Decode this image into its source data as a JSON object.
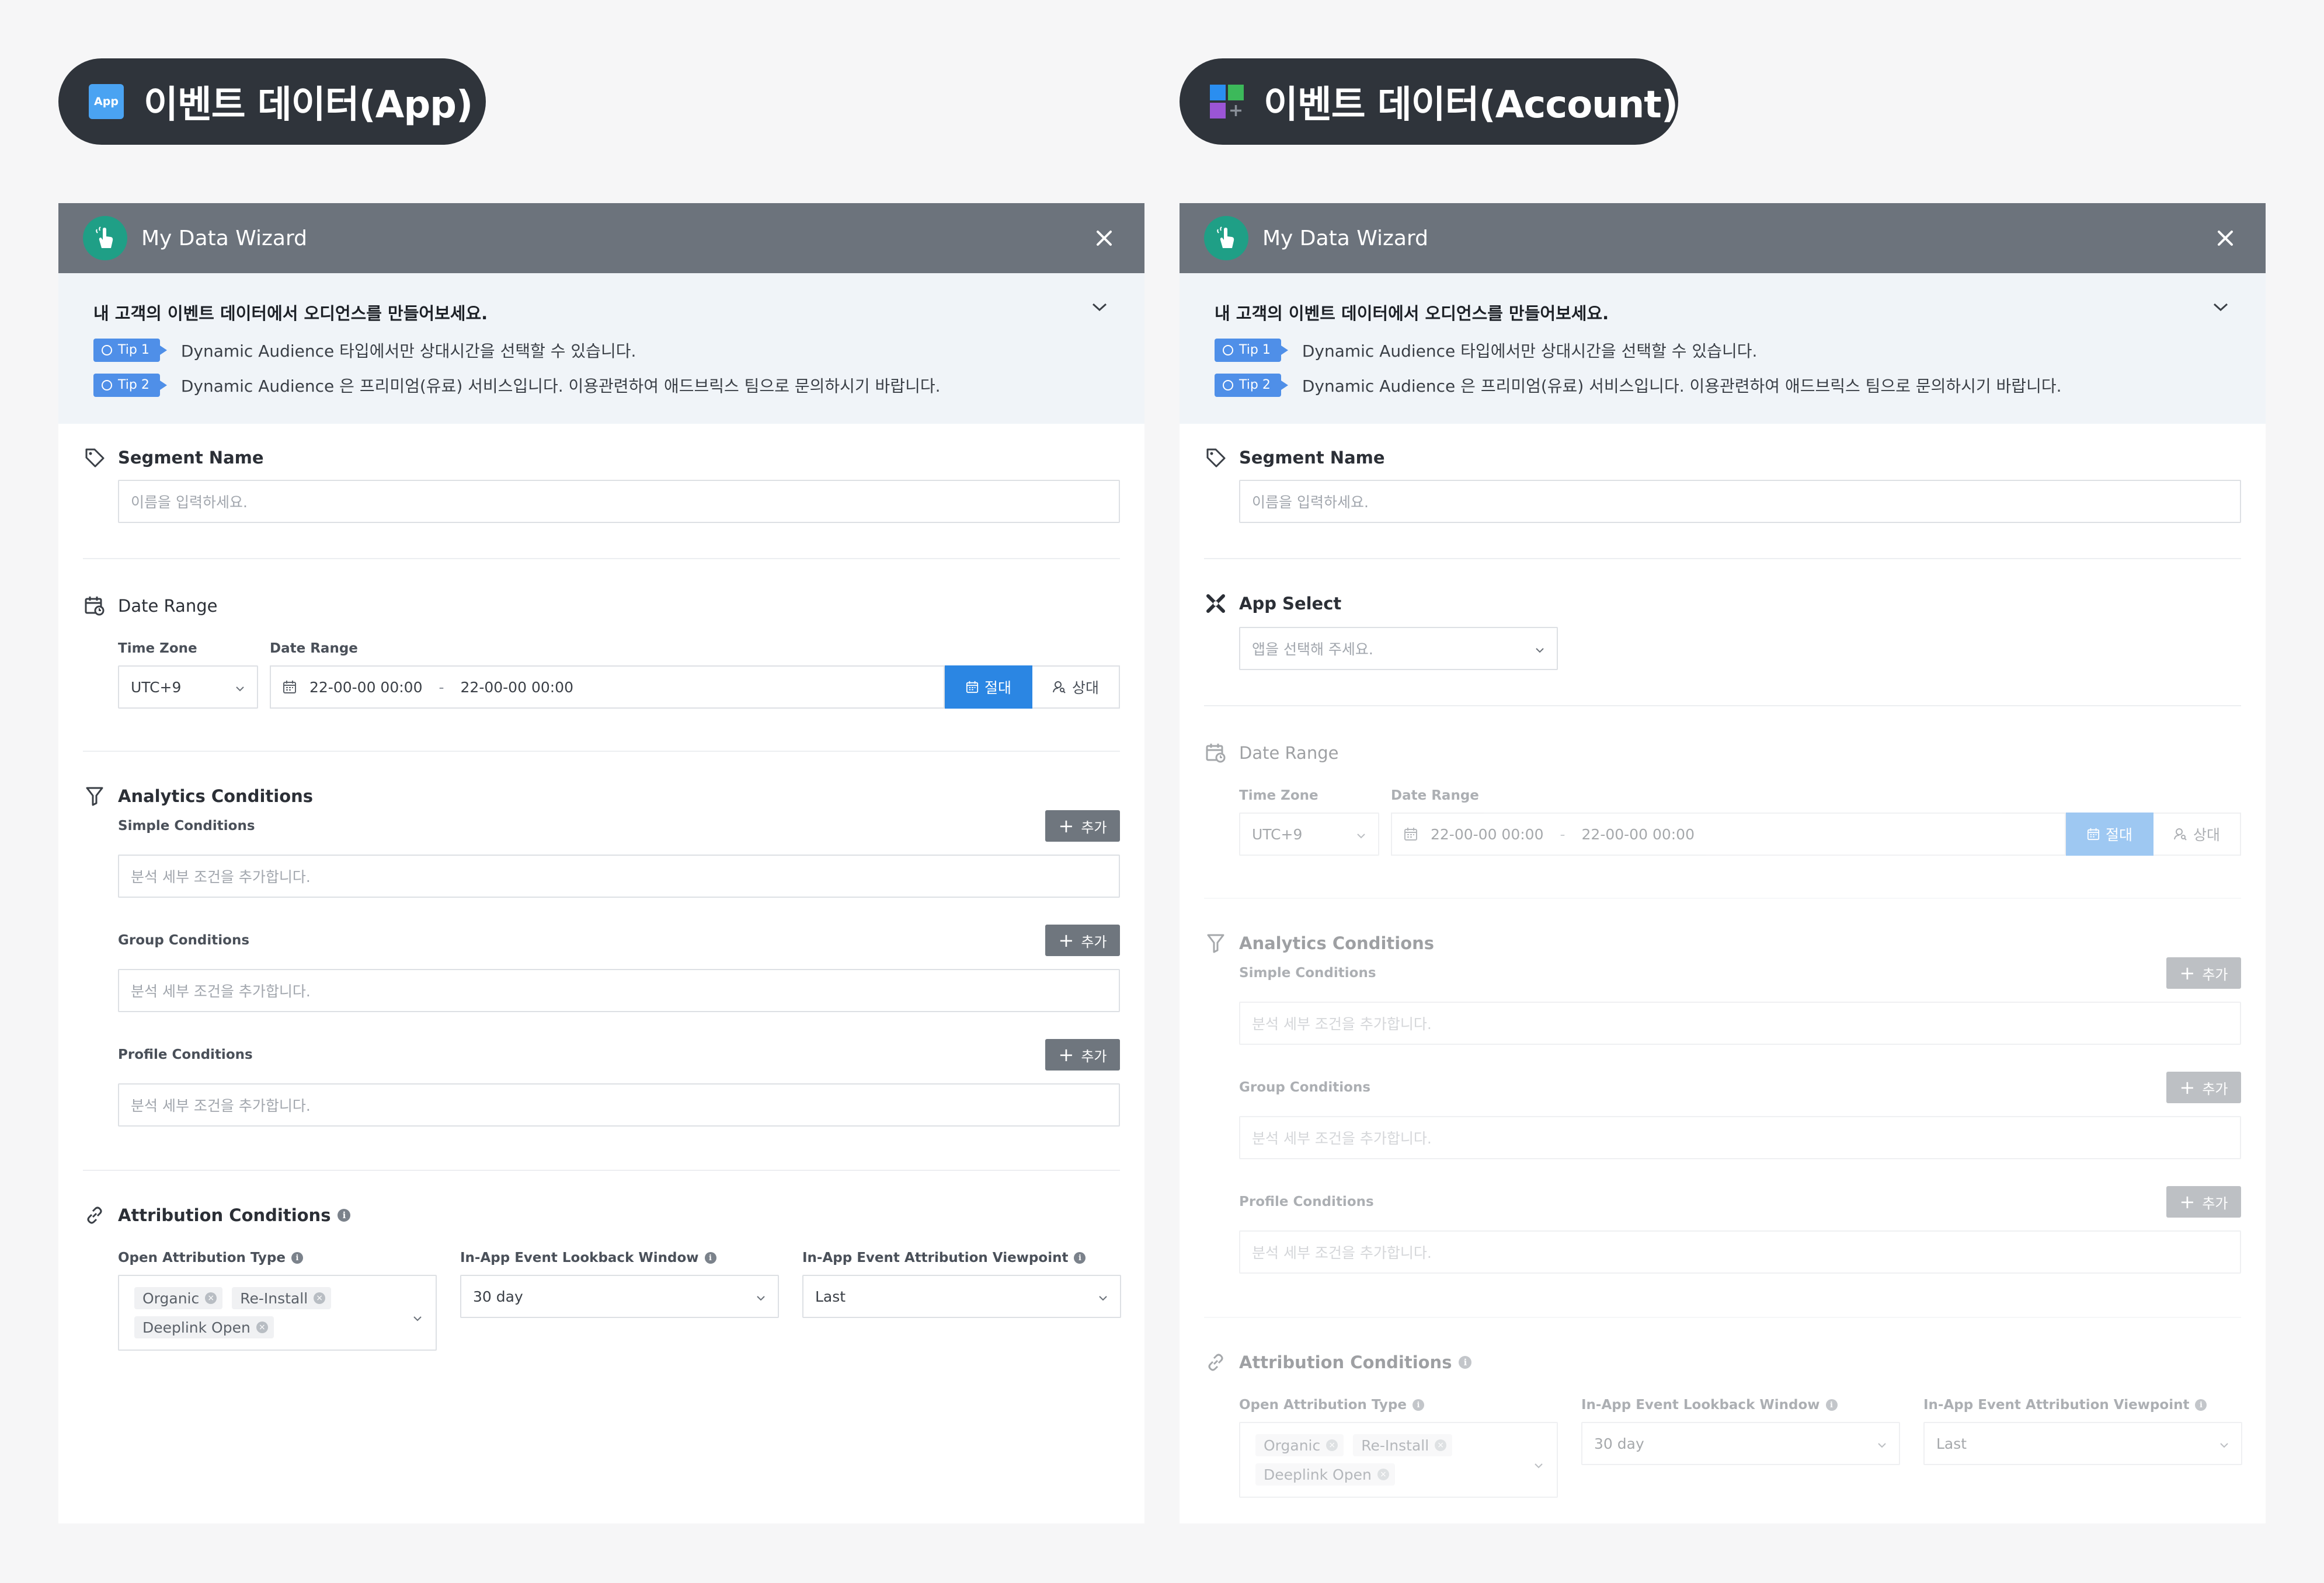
{
  "pills": {
    "app": {
      "title": "이벤트 데이터(App)",
      "tile_text": "App"
    },
    "account": {
      "title": "이벤트 데이터(Account)"
    }
  },
  "colors": {
    "pill_bg": "#2f343b",
    "header_bg": "#6c737c",
    "wizard_logo": "#1f9f86",
    "tip_badge": "#4f8fe8",
    "primary": "#2b86e3",
    "add_button": "#6f767e",
    "mosaic": [
      "#2a8ef0",
      "#3cb95a",
      "#9b55d6",
      "#8a9099"
    ]
  },
  "wizard": {
    "title": "My Data Wizard",
    "intro": "내 고객의 이벤트 데이터에서 오디언스를 만들어보세요.",
    "tips": [
      {
        "badge": "Tip 1",
        "text": "Dynamic Audience 타입에서만 상대시간을 선택할 수 있습니다."
      },
      {
        "badge": "Tip 2",
        "text": "Dynamic Audience 은 프리미엄(유료) 서비스입니다. 이용관련하여 애드브릭스 팀으로 문의하시기 바랍니다."
      }
    ]
  },
  "segment": {
    "label": "Segment Name",
    "placeholder": "이름을 입력하세요."
  },
  "app_select": {
    "label": "App Select",
    "placeholder": "앱을 선택해 주세요."
  },
  "date_range": {
    "label": "Date Range",
    "timezone_label": "Time Zone",
    "timezone_value": "UTC+9",
    "range_label": "Date Range",
    "start": "22-00-00 00:00",
    "separator": "-",
    "end": "22-00-00 00:00",
    "absolute": "절대",
    "relative": "상대"
  },
  "analytics": {
    "label": "Analytics Conditions",
    "add": "추가",
    "placeholder": "분석 세부 조건을 추가합니다.",
    "groups": [
      {
        "label": "Simple Conditions"
      },
      {
        "label": "Group Conditions"
      },
      {
        "label": "Profile Conditions"
      }
    ]
  },
  "attribution": {
    "label": "Attribution Conditions",
    "open_type_label": "Open Attribution Type",
    "open_type_tags": [
      "Organic",
      "Re-Install",
      "Deeplink Open"
    ],
    "lookback_label": "In-App Event Lookback Window",
    "lookback_value": "30 day",
    "viewpoint_label": "In-App Event Attribution Viewpoint",
    "viewpoint_value": "Last"
  },
  "icons": [
    "app-tile-icon",
    "mosaic-icon",
    "wizard-hand-icon",
    "close-icon",
    "chevron-down-icon",
    "lightbulb-icon",
    "tag-icon",
    "app-select-icon",
    "calendar-clock-icon",
    "calendar-icon",
    "user-search-icon",
    "filter-icon",
    "plus-icon",
    "link-icon",
    "info-icon",
    "remove-tag-icon"
  ]
}
